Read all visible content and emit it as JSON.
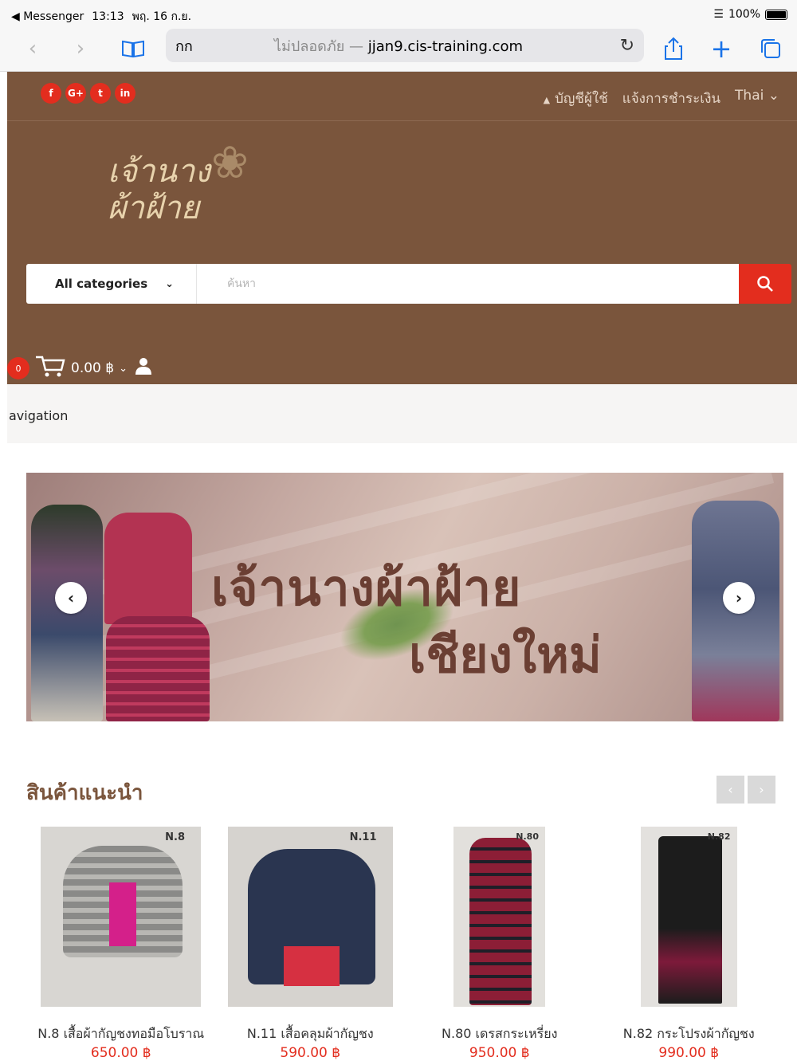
{
  "status_bar": {
    "back_app": "◀ Messenger",
    "time": "13:13",
    "date": "พฤ. 16 ก.ย.",
    "battery": "100%"
  },
  "browser": {
    "text_size": "กก",
    "url_insecure": "ไม่ปลอดภัย —",
    "url_host": "jjan9.cis-training.com"
  },
  "header": {
    "social": [
      "f",
      "G+",
      "t",
      "in"
    ],
    "account_label": "บัญชีผู้ใช้",
    "payment_label": "แจ้งการชำระเงิน",
    "language": "Thai",
    "logo_line1": "เจ้านาง",
    "logo_line2": "ผ้าฝ้าย"
  },
  "search": {
    "category_label": "All categories",
    "placeholder": "ค้นหา"
  },
  "cart": {
    "count": "0",
    "total": "0.00 ฿"
  },
  "nav": {
    "label": "avigation"
  },
  "banner": {
    "title": "เจ้านางผ้าฝ้าย",
    "subtitle": "เชียงใหม่"
  },
  "featured": {
    "title": "สินค้าแนะนำ",
    "products": [
      {
        "tag": "N.8",
        "name": "N.8 เสื้อผ้ากัญชงทอมือโบราณ",
        "price": "650.00 ฿"
      },
      {
        "tag": "N.11",
        "name": "N.11 เสื้อคลุมผ้ากัญชง",
        "price": "590.00 ฿"
      },
      {
        "tag": "N.80",
        "name": "N.80 เดรสกระเหรี่ยง",
        "price": "950.00 ฿"
      },
      {
        "tag": "N.82",
        "name": "N.82 กระโปรงผ้ากัญชง",
        "price": "990.00 ฿"
      }
    ]
  },
  "colors": {
    "header_brown": "#7a553c",
    "accent_red": "#e32d1e",
    "ios_blue": "#1a73e8"
  }
}
